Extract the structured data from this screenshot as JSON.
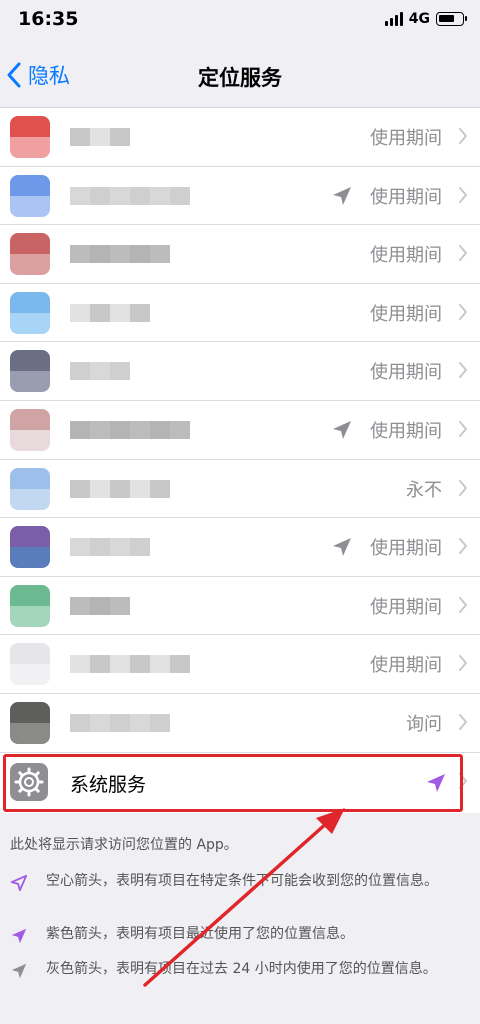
{
  "status_bar": {
    "time": "16:35",
    "network": "4G",
    "battery_level": 0.7
  },
  "nav": {
    "back_label": "隐私",
    "title": "定位服务"
  },
  "apps": [
    {
      "value": "使用期间",
      "arrow": "none",
      "icon_colors": [
        "#e0504d",
        "#f0a0a0"
      ]
    },
    {
      "value": "使用期间",
      "arrow": "gray",
      "icon_colors": [
        "#6e98e8",
        "#aac4f4"
      ]
    },
    {
      "value": "使用期间",
      "arrow": "none",
      "icon_colors": [
        "#c96464",
        "#dca0a0"
      ]
    },
    {
      "value": "使用期间",
      "arrow": "none",
      "icon_colors": [
        "#7ab8ee",
        "#a8d4f6"
      ]
    },
    {
      "value": "使用期间",
      "arrow": "none",
      "icon_colors": [
        "#6b6f86",
        "#9a9cb0"
      ]
    },
    {
      "value": "使用期间",
      "arrow": "gray",
      "icon_colors": [
        "#d0a4a4",
        "#e8dada"
      ]
    },
    {
      "value": "永不",
      "arrow": "none",
      "icon_colors": [
        "#9cc0ea",
        "#c2d8f2"
      ]
    },
    {
      "value": "使用期间",
      "arrow": "gray",
      "icon_colors": [
        "#7b5ea8",
        "#5a7cba"
      ]
    },
    {
      "value": "使用期间",
      "arrow": "none",
      "icon_colors": [
        "#6cba92",
        "#a4d6bc"
      ]
    },
    {
      "value": "使用期间",
      "arrow": "none",
      "icon_colors": [
        "#e6e6ea",
        "#f1f1f3"
      ]
    },
    {
      "value": "询问",
      "arrow": "none",
      "icon_colors": [
        "#5e5e5a",
        "#8a8a86"
      ]
    }
  ],
  "system_services": {
    "label": "系统服务",
    "arrow": "purple"
  },
  "footer": {
    "note": "此处将显示请求访问您位置的 App。",
    "legend": [
      {
        "type": "hollow",
        "text": "空心箭头，表明有项目在特定条件下可能会收到您的位置信息。"
      },
      {
        "type": "purple",
        "text": "紫色箭头，表明有项目最近使用了您的位置信息。"
      },
      {
        "type": "gray",
        "text": "灰色箭头，表明有项目在过去 24 小时内使用了您的位置信息。"
      }
    ]
  },
  "colors": {
    "accent": "#0a7aff",
    "purple_arrow": "#a259e6",
    "gray_arrow": "#8e8e93",
    "highlight": "#e0262a"
  }
}
